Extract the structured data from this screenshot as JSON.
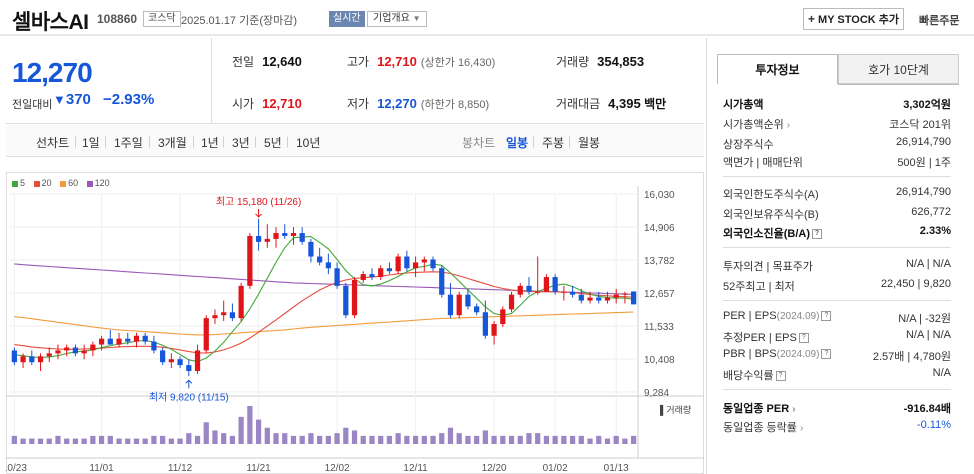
{
  "header": {
    "stock_name": "셀바스AI",
    "stock_code": "108860",
    "market": "코스닥",
    "date_text": "2025.01.17  기준(장마감)",
    "realtime_label": "실시간",
    "overview_label": "기업개요",
    "mystock_label": "MY STOCK 추가",
    "quick_order_label": "빠른주문"
  },
  "summary": {
    "price": "12,270",
    "change_label": "전일대비",
    "change_value": "370",
    "change_pct": "−2.93%",
    "prev_label": "전일",
    "prev_value": "12,640",
    "high_label": "고가",
    "high_value": "12,710",
    "upper_limit": "(상한가 16,430)",
    "volume_label": "거래량",
    "volume_value": "354,853",
    "open_label": "시가",
    "open_value": "12,710",
    "low_label": "저가",
    "low_value": "12,270",
    "lower_limit": "(하한가 8,850)",
    "amount_label": "거래대금",
    "amount_value": "4,395",
    "amount_unit": "백만"
  },
  "tabs": {
    "line_chart": "선차트",
    "d1": "1일",
    "w1": "1주일",
    "m3": "3개월",
    "y1": "1년",
    "y3": "3년",
    "y5": "5년",
    "y10": "10년",
    "candle": "봉차트",
    "daily": "일봉",
    "weekly": "주봉",
    "monthly": "월봉"
  },
  "colors": {
    "up": "#e0151a",
    "down": "#1656d9",
    "ma5": "#43a83a",
    "ma20": "#e74c3c",
    "ma60": "#f39c3c",
    "ma120": "#9b59b6"
  },
  "chart_data": {
    "type": "candlestick",
    "legend": [
      "5",
      "20",
      "60",
      "120"
    ],
    "y_ticks": [
      "16,030",
      "14,906",
      "13,782",
      "12,657",
      "11,533",
      "10,408",
      "9,284"
    ],
    "ylim": [
      9284,
      16030
    ],
    "x_ticks": [
      "10/23",
      "11/01",
      "11/12",
      "11/21",
      "12/02",
      "12/11",
      "12/20",
      "01/02",
      "01/13"
    ],
    "max_label": "최고 15,180 (11/26)",
    "min_label": "최저 9,820 (11/15)",
    "volume_label": "거래량",
    "candles": [
      {
        "o": 10700,
        "h": 10800,
        "l": 10200,
        "c": 10300
      },
      {
        "o": 10300,
        "h": 10600,
        "l": 10100,
        "c": 10500
      },
      {
        "o": 10500,
        "h": 10700,
        "l": 10200,
        "c": 10300
      },
      {
        "o": 10300,
        "h": 10600,
        "l": 10000,
        "c": 10500
      },
      {
        "o": 10500,
        "h": 10800,
        "l": 10300,
        "c": 10600
      },
      {
        "o": 10600,
        "h": 10900,
        "l": 10400,
        "c": 10700
      },
      {
        "o": 10700,
        "h": 10900,
        "l": 10500,
        "c": 10800
      },
      {
        "o": 10800,
        "h": 10900,
        "l": 10500,
        "c": 10600
      },
      {
        "o": 10600,
        "h": 10900,
        "l": 10400,
        "c": 10700
      },
      {
        "o": 10700,
        "h": 11000,
        "l": 10500,
        "c": 10900
      },
      {
        "o": 10900,
        "h": 11200,
        "l": 10700,
        "c": 11100
      },
      {
        "o": 11100,
        "h": 11400,
        "l": 10900,
        "c": 10900
      },
      {
        "o": 10900,
        "h": 11300,
        "l": 10800,
        "c": 11100
      },
      {
        "o": 11100,
        "h": 11300,
        "l": 10900,
        "c": 11000
      },
      {
        "o": 11000,
        "h": 11300,
        "l": 10800,
        "c": 11200
      },
      {
        "o": 11200,
        "h": 11300,
        "l": 10900,
        "c": 11000
      },
      {
        "o": 11000,
        "h": 11200,
        "l": 10600,
        "c": 10700
      },
      {
        "o": 10700,
        "h": 10800,
        "l": 10200,
        "c": 10300
      },
      {
        "o": 10300,
        "h": 10600,
        "l": 10100,
        "c": 10400
      },
      {
        "o": 10400,
        "h": 10500,
        "l": 10100,
        "c": 10200
      },
      {
        "o": 10200,
        "h": 10400,
        "l": 9820,
        "c": 10000
      },
      {
        "o": 10000,
        "h": 10900,
        "l": 9900,
        "c": 10700
      },
      {
        "o": 10700,
        "h": 11900,
        "l": 10600,
        "c": 11800
      },
      {
        "o": 11800,
        "h": 12100,
        "l": 11600,
        "c": 11900
      },
      {
        "o": 11900,
        "h": 12400,
        "l": 11700,
        "c": 12000
      },
      {
        "o": 12000,
        "h": 12300,
        "l": 11700,
        "c": 11800
      },
      {
        "o": 11800,
        "h": 13000,
        "l": 11700,
        "c": 12900
      },
      {
        "o": 12900,
        "h": 14700,
        "l": 12800,
        "c": 14600
      },
      {
        "o": 14600,
        "h": 15180,
        "l": 14100,
        "c": 14400
      },
      {
        "o": 14400,
        "h": 15000,
        "l": 14200,
        "c": 14500
      },
      {
        "o": 14500,
        "h": 14900,
        "l": 14200,
        "c": 14700
      },
      {
        "o": 14700,
        "h": 15000,
        "l": 14500,
        "c": 14600
      },
      {
        "o": 14600,
        "h": 14900,
        "l": 14300,
        "c": 14700
      },
      {
        "o": 14700,
        "h": 14900,
        "l": 14300,
        "c": 14400
      },
      {
        "o": 14400,
        "h": 14500,
        "l": 13700,
        "c": 13900
      },
      {
        "o": 13900,
        "h": 14200,
        "l": 13600,
        "c": 13700
      },
      {
        "o": 13700,
        "h": 14000,
        "l": 13300,
        "c": 13500
      },
      {
        "o": 13500,
        "h": 13700,
        "l": 12800,
        "c": 12900
      },
      {
        "o": 12900,
        "h": 13000,
        "l": 11800,
        "c": 11900
      },
      {
        "o": 11900,
        "h": 13200,
        "l": 11800,
        "c": 13100
      },
      {
        "o": 13100,
        "h": 13400,
        "l": 13000,
        "c": 13300
      },
      {
        "o": 13300,
        "h": 13500,
        "l": 13100,
        "c": 13200
      },
      {
        "o": 13200,
        "h": 13600,
        "l": 13100,
        "c": 13500
      },
      {
        "o": 13500,
        "h": 13700,
        "l": 13300,
        "c": 13400
      },
      {
        "o": 13400,
        "h": 14000,
        "l": 13300,
        "c": 13900
      },
      {
        "o": 13900,
        "h": 14100,
        "l": 13400,
        "c": 13500
      },
      {
        "o": 13500,
        "h": 13900,
        "l": 13200,
        "c": 13700
      },
      {
        "o": 13700,
        "h": 13900,
        "l": 13400,
        "c": 13800
      },
      {
        "o": 13800,
        "h": 13900,
        "l": 13400,
        "c": 13500
      },
      {
        "o": 13500,
        "h": 13600,
        "l": 12500,
        "c": 12600
      },
      {
        "o": 12600,
        "h": 13000,
        "l": 11800,
        "c": 11900
      },
      {
        "o": 11900,
        "h": 12700,
        "l": 11800,
        "c": 12600
      },
      {
        "o": 12600,
        "h": 12800,
        "l": 12100,
        "c": 12200
      },
      {
        "o": 12200,
        "h": 12300,
        "l": 11900,
        "c": 12000
      },
      {
        "o": 12000,
        "h": 12400,
        "l": 11100,
        "c": 11200
      },
      {
        "o": 11200,
        "h": 11700,
        "l": 10900,
        "c": 11600
      },
      {
        "o": 11600,
        "h": 12200,
        "l": 11500,
        "c": 12100
      },
      {
        "o": 12100,
        "h": 12700,
        "l": 12000,
        "c": 12600
      },
      {
        "o": 12600,
        "h": 13000,
        "l": 12500,
        "c": 12900
      },
      {
        "o": 12900,
        "h": 13200,
        "l": 12600,
        "c": 12700
      },
      {
        "o": 12700,
        "h": 13900,
        "l": 12600,
        "c": 12700
      },
      {
        "o": 12700,
        "h": 13300,
        "l": 12700,
        "c": 13200
      },
      {
        "o": 13200,
        "h": 13300,
        "l": 12600,
        "c": 12700
      },
      {
        "o": 12700,
        "h": 12900,
        "l": 12400,
        "c": 12700
      },
      {
        "o": 12700,
        "h": 12900,
        "l": 12500,
        "c": 12600
      },
      {
        "o": 12600,
        "h": 12800,
        "l": 12300,
        "c": 12400
      },
      {
        "o": 12400,
        "h": 12700,
        "l": 12300,
        "c": 12500
      },
      {
        "o": 12500,
        "h": 12700,
        "l": 12300,
        "c": 12400
      },
      {
        "o": 12400,
        "h": 12700,
        "l": 12300,
        "c": 12500
      },
      {
        "o": 12500,
        "h": 12800,
        "l": 12300,
        "c": 12600
      },
      {
        "o": 12600,
        "h": 12700,
        "l": 12300,
        "c": 12640
      },
      {
        "o": 12710,
        "h": 12710,
        "l": 12270,
        "c": 12270
      }
    ],
    "ma5": [
      10550,
      10520,
      10480,
      10460,
      10480,
      10520,
      10600,
      10650,
      10680,
      10720,
      10800,
      10860,
      10920,
      10960,
      11020,
      11040,
      10980,
      10880,
      10740,
      10560,
      10380,
      10320,
      10440,
      10680,
      10980,
      11340,
      11680,
      12120,
      12620,
      13160,
      13700,
      14200,
      14540,
      14560,
      14580,
      14380,
      14160,
      13800,
      13420,
      13140,
      12940,
      12900,
      12960,
      13080,
      13220,
      13380,
      13520,
      13560,
      13640,
      13600,
      13340,
      13060,
      12760,
      12480,
      12180,
      11960,
      11900,
      11960,
      12240,
      12540,
      12700,
      12820,
      12920,
      12960,
      12880,
      12740,
      12620,
      12540,
      12500,
      12480,
      12490,
      12440
    ],
    "ma20": [
      10900,
      10860,
      10820,
      10790,
      10770,
      10750,
      10740,
      10740,
      10750,
      10760,
      10780,
      10800,
      10820,
      10830,
      10840,
      10840,
      10830,
      10810,
      10770,
      10720,
      10660,
      10620,
      10610,
      10650,
      10720,
      10820,
      10950,
      11120,
      11320,
      11530,
      11740,
      11960,
      12180,
      12390,
      12580,
      12760,
      12900,
      13020,
      13100,
      13150,
      13180,
      13200,
      13230,
      13270,
      13310,
      13340,
      13360,
      13370,
      13380,
      13370,
      13320,
      13240,
      13150,
      13060,
      12970,
      12880,
      12810,
      12760,
      12730,
      12710,
      12700,
      12700,
      12700,
      12690,
      12670,
      12640,
      12610,
      12580,
      12560,
      12540,
      12530,
      12510
    ],
    "ma60": [
      11850,
      11820,
      11780,
      11740,
      11700,
      11660,
      11620,
      11580,
      11540,
      11500,
      11460,
      11430,
      11400,
      11380,
      11360,
      11340,
      11320,
      11300,
      11280,
      11260,
      11240,
      11230,
      11230,
      11240,
      11260,
      11280,
      11300,
      11320,
      11340,
      11360,
      11380,
      11400,
      11430,
      11460,
      11490,
      11510,
      11530,
      11550,
      11570,
      11590,
      11610,
      11630,
      11650,
      11670,
      11690,
      11710,
      11730,
      11750,
      11770,
      11790,
      11800,
      11810,
      11820,
      11830,
      11840,
      11850,
      11860,
      11870,
      11880,
      11890,
      11900,
      11910,
      11920,
      11930,
      11940,
      11950,
      11960,
      11970,
      11980,
      11990,
      12000,
      12010
    ],
    "ma120": [
      13650,
      13620,
      13600,
      13580,
      13560,
      13540,
      13520,
      13500,
      13480,
      13460,
      13440,
      13420,
      13400,
      13380,
      13360,
      13340,
      13320,
      13300,
      13280,
      13260,
      13240,
      13220,
      13200,
      13180,
      13160,
      13140,
      13120,
      13100,
      13080,
      13060,
      13040,
      13020,
      13000,
      12990,
      12980,
      12970,
      12960,
      12950,
      12940,
      12930,
      12920,
      12910,
      12900,
      12890,
      12880,
      12870,
      12860,
      12850,
      12840,
      12830,
      12820,
      12810,
      12800,
      12790,
      12780,
      12770,
      12760,
      12750,
      12740,
      12730,
      12720,
      12710,
      12700,
      12690,
      12680,
      12670,
      12660,
      12650,
      12640,
      12630,
      12620,
      12610
    ],
    "volume": [
      3,
      2,
      2,
      2,
      2,
      3,
      2,
      2,
      2,
      3,
      3,
      3,
      2,
      2,
      2,
      2,
      3,
      3,
      2,
      2,
      4,
      3,
      8,
      5,
      4,
      3,
      10,
      14,
      9,
      6,
      4,
      4,
      3,
      3,
      4,
      3,
      3,
      4,
      6,
      5,
      3,
      3,
      3,
      3,
      4,
      3,
      3,
      3,
      3,
      4,
      6,
      4,
      3,
      3,
      5,
      3,
      3,
      3,
      3,
      4,
      4,
      3,
      3,
      3,
      3,
      3,
      2,
      3,
      2,
      3,
      2,
      3
    ]
  },
  "info": {
    "tab_invest": "투자정보",
    "tab_quote": "호가 10단계",
    "market_cap_label": "시가총액",
    "market_cap_value": "3,302억원",
    "cap_rank_label": "시가총액순위",
    "cap_rank_value": "코스닥 201위",
    "shares_label": "상장주식수",
    "shares_value": "26,914,790",
    "par_label": "액면가 | 매매단위",
    "par_value": "500원 | 1주",
    "foreign_limit_label": "외국인한도주식수(A)",
    "foreign_limit_value": "26,914,790",
    "foreign_hold_label": "외국인보유주식수(B)",
    "foreign_hold_value": "626,772",
    "foreign_ratio_label": "외국인소진율(B/A)",
    "foreign_ratio_value": "2.33%",
    "opinion_label": "투자의견 | 목표주가",
    "opinion_value": "N/A | N/A",
    "week52_label": "52주최고 | 최저",
    "week52_value": "22,450 | 9,820",
    "per_label": "PER | EPS",
    "per_period": "(2024.09)",
    "per_value": "N/A | -32원",
    "est_per_label": "추정PER | EPS",
    "est_per_value": "N/A | N/A",
    "pbr_label": "PBR | BPS",
    "pbr_period": "(2024.09)",
    "pbr_value": "2.57배 | 4,780원",
    "div_label": "배당수익률",
    "div_value": "N/A",
    "sector_per_label": "동일업종 PER",
    "sector_per_value": "-916.84배",
    "sector_chg_label": "동일업종 등락률",
    "sector_chg_value": "-0.11%"
  }
}
